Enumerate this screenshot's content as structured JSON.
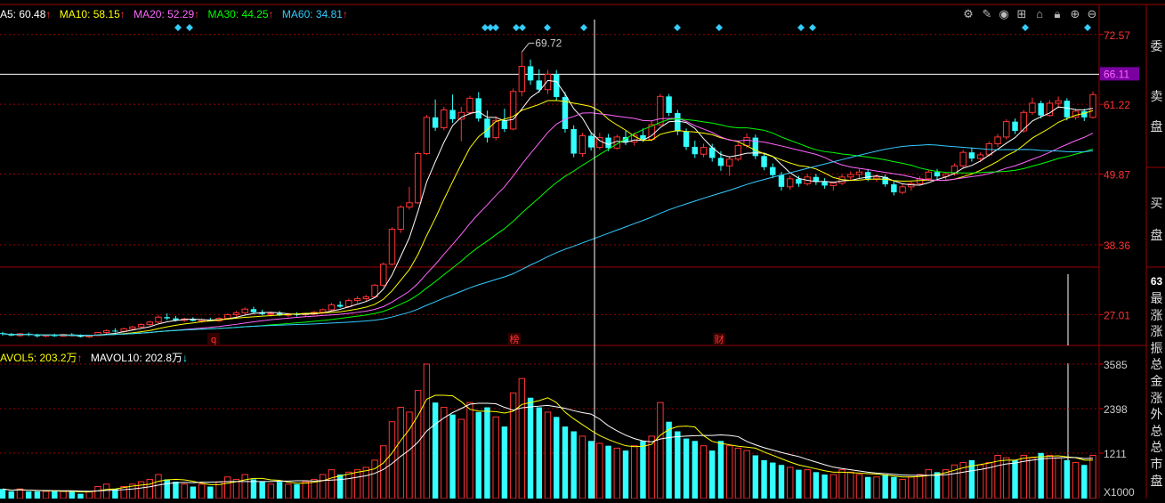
{
  "price_legend": [
    {
      "label": "A5: 60.48",
      "arrow": "↑",
      "color": "#ffffff"
    },
    {
      "label": "MA10: 58.15",
      "arrow": "↑",
      "color": "#ffff00"
    },
    {
      "label": "MA20: 52.29",
      "arrow": "↑",
      "color": "#ff66ff"
    },
    {
      "label": "MA30: 44.25",
      "arrow": "↑",
      "color": "#00ff00"
    },
    {
      "label": "MA60: 34.81",
      "arrow": "↑",
      "color": "#33ccff"
    }
  ],
  "volume_legend": [
    {
      "label": "AVOL5: 203.2万",
      "arrow": "↑",
      "color": "#ffff00"
    },
    {
      "label": "MAVOL10: 202.8万",
      "arrow": "↓",
      "color": "#ffffff"
    }
  ],
  "price_axis": [
    "72.57",
    "61.22",
    "49.87",
    "38.36",
    "27.01"
  ],
  "current_price": "66.11",
  "high_annotation": "69.72",
  "volume_axis": [
    "3585",
    "2398",
    "1211"
  ],
  "volume_unit": "X1000",
  "event_markers": [
    {
      "text": "q",
      "color": "#ff3333"
    },
    {
      "text": "榜",
      "color": "#ff3333"
    },
    {
      "text": "财",
      "color": "#ff3333"
    }
  ],
  "side_panel": {
    "top": "委",
    "sell": [
      "卖",
      "盘"
    ],
    "buy": [
      "买",
      "盘"
    ],
    "number": "63",
    "labels": [
      "最",
      "涨",
      "涨",
      "振",
      "总",
      "金",
      "涨",
      "外",
      "总",
      "总",
      "市",
      "盘"
    ]
  },
  "colors": {
    "up": "#ff3333",
    "down": "#33ffff",
    "grid": "#990000",
    "ma5": "#ffffff",
    "ma10": "#ffff00",
    "ma20": "#ff66ff",
    "ma30": "#00ff00",
    "ma60": "#33ccff"
  },
  "chart_data": {
    "type": "candlestick",
    "ylim": [
      22,
      75
    ],
    "yticks": [
      72.57,
      61.22,
      49.87,
      38.36,
      27.01
    ],
    "high": 69.72,
    "last": 66.11,
    "volume_ticks": [
      3585,
      2398,
      1211
    ],
    "candles": [
      [
        24,
        24.2,
        23.6,
        23.9
      ],
      [
        23.9,
        24,
        23.5,
        23.6
      ],
      [
        23.6,
        24,
        23.4,
        23.9
      ],
      [
        23.9,
        24.1,
        23.5,
        23.7
      ],
      [
        23.7,
        23.9,
        23.3,
        23.5
      ],
      [
        23.5,
        23.8,
        23.3,
        23.7
      ],
      [
        23.7,
        23.9,
        23.4,
        23.5
      ],
      [
        23.5,
        23.9,
        23.4,
        23.8
      ],
      [
        23.8,
        24,
        23.5,
        23.6
      ],
      [
        23.6,
        23.8,
        23.3,
        23.4
      ],
      [
        23.4,
        23.7,
        23.2,
        23.6
      ],
      [
        23.6,
        24.2,
        23.5,
        24.1
      ],
      [
        24.1,
        24.6,
        23.9,
        24.4
      ],
      [
        24.4,
        24.8,
        24.1,
        24.3
      ],
      [
        24.3,
        24.9,
        24.1,
        24.7
      ],
      [
        24.7,
        25.2,
        24.5,
        25
      ],
      [
        25,
        25.6,
        24.8,
        25.4
      ],
      [
        25.4,
        26,
        25.2,
        25.8
      ],
      [
        25.8,
        26.9,
        25.6,
        26.6
      ],
      [
        26.6,
        27.2,
        26.1,
        26.4
      ],
      [
        26.4,
        26.8,
        25.9,
        26.1
      ],
      [
        26.1,
        26.5,
        25.8,
        26.3
      ],
      [
        26.3,
        26.6,
        25.9,
        26
      ],
      [
        26,
        26.4,
        25.7,
        26.2
      ],
      [
        26.2,
        26.5,
        25.9,
        26
      ],
      [
        26,
        26.6,
        25.8,
        26.4
      ],
      [
        26.4,
        27.2,
        26.2,
        27
      ],
      [
        27,
        27.6,
        26.7,
        27.3
      ],
      [
        27.3,
        28.2,
        27,
        27.9
      ],
      [
        27.9,
        28.3,
        27.2,
        27.4
      ],
      [
        27.4,
        27.8,
        26.9,
        27.1
      ],
      [
        27.1,
        27.5,
        26.7,
        27.2
      ],
      [
        27.2,
        27.6,
        26.8,
        26.9
      ],
      [
        26.9,
        27.3,
        26.6,
        27.1
      ],
      [
        27.1,
        27.4,
        26.7,
        27
      ],
      [
        27,
        27.3,
        26.7,
        27.2
      ],
      [
        27.2,
        27.6,
        26.9,
        27.4
      ],
      [
        27.4,
        28,
        27.1,
        27.8
      ],
      [
        27.8,
        28.9,
        27.6,
        28.6
      ],
      [
        28.6,
        29.2,
        28.1,
        28.3
      ],
      [
        28.3,
        29.6,
        28.1,
        29.3
      ],
      [
        29.3,
        30,
        28.9,
        29.6
      ],
      [
        29.6,
        30.2,
        29.2,
        29.9
      ],
      [
        29.9,
        32,
        29.7,
        31.8
      ],
      [
        31.8,
        35.5,
        31.5,
        35.2
      ],
      [
        35.2,
        41.2,
        35,
        40.9
      ],
      [
        40.9,
        44.8,
        40.3,
        44.5
      ],
      [
        44.5,
        47.8,
        44.1,
        45.2
      ],
      [
        45.2,
        53.5,
        45,
        53.2
      ],
      [
        53.2,
        59.5,
        53,
        59.1
      ],
      [
        59.1,
        62,
        56.9,
        57.4
      ],
      [
        57.4,
        60.8,
        57,
        60.3
      ],
      [
        60.3,
        62.8,
        58.2,
        58.8
      ],
      [
        58.8,
        60.8,
        55.2,
        59.9
      ],
      [
        59.9,
        62.6,
        59.5,
        62.2
      ],
      [
        62.2,
        63.2,
        58.4,
        58.9
      ],
      [
        58.9,
        60.2,
        55,
        55.8
      ],
      [
        55.8,
        59.3,
        55.4,
        58.6
      ],
      [
        58.6,
        60.5,
        56.7,
        57.2
      ],
      [
        57.2,
        63.8,
        57,
        63.3
      ],
      [
        63.3,
        69.72,
        62.5,
        67.4
      ],
      [
        67.4,
        68.5,
        64.4,
        65.1
      ],
      [
        65.1,
        66.9,
        63.1,
        63.6
      ],
      [
        63.6,
        66.8,
        62.9,
        66.1
      ],
      [
        66.1,
        66.8,
        61.8,
        62.4
      ],
      [
        62.4,
        63.2,
        56.6,
        57.2
      ],
      [
        57.2,
        57.8,
        52.6,
        53.2
      ],
      [
        53.2,
        56.6,
        52.7,
        56.1
      ],
      [
        56.1,
        56.6,
        53.7,
        54.2
      ],
      [
        54.2,
        56.6,
        53.9,
        55.8
      ],
      [
        55.8,
        56.4,
        53.6,
        54.1
      ],
      [
        54.1,
        56.3,
        53.8,
        55.9
      ],
      [
        55.9,
        56.9,
        54.6,
        55.1
      ],
      [
        55.1,
        56.6,
        54.5,
        56.2
      ],
      [
        56.2,
        57.3,
        55.1,
        55.5
      ],
      [
        55.5,
        58.6,
        55.2,
        57.9
      ],
      [
        57.9,
        62.9,
        57.7,
        62.5
      ],
      [
        62.5,
        62.9,
        59.3,
        59.8
      ],
      [
        59.8,
        60.3,
        56.2,
        56.8
      ],
      [
        56.8,
        57.3,
        53.8,
        54.3
      ],
      [
        54.3,
        55.3,
        52.5,
        53.1
      ],
      [
        53.1,
        54.8,
        52.6,
        54.2
      ],
      [
        54.2,
        54.8,
        51.9,
        52.5
      ],
      [
        52.5,
        53.6,
        50.4,
        51.2
      ],
      [
        51.2,
        52.8,
        49.6,
        52.3
      ],
      [
        52.3,
        54.9,
        52,
        54.5
      ],
      [
        54.5,
        56.5,
        54.1,
        55.8
      ],
      [
        55.8,
        56.3,
        52.3,
        52.8
      ],
      [
        52.8,
        53.3,
        50.5,
        51
      ],
      [
        51,
        51.6,
        49.2,
        49.7
      ],
      [
        49.7,
        50.2,
        47.2,
        47.8
      ],
      [
        47.8,
        49.6,
        47.3,
        49.1
      ],
      [
        49.1,
        49.6,
        47.8,
        48.3
      ],
      [
        48.3,
        49.9,
        48,
        49.4
      ],
      [
        49.4,
        49.9,
        48.1,
        48.6
      ],
      [
        48.6,
        49.2,
        47.5,
        48
      ],
      [
        48,
        48.6,
        47.2,
        48.4
      ],
      [
        48.4,
        49.8,
        48.1,
        49.4
      ],
      [
        49.4,
        50.3,
        48.9,
        49.8
      ],
      [
        49.8,
        50.7,
        49.2,
        50.2
      ],
      [
        50.2,
        50.7,
        48.7,
        49.1
      ],
      [
        49.1,
        49.8,
        48.6,
        49.4
      ],
      [
        49.4,
        49.8,
        47.8,
        48.2
      ],
      [
        48.2,
        48.7,
        46.4,
        46.9
      ],
      [
        46.9,
        48.2,
        46.6,
        47.8
      ],
      [
        47.8,
        48.7,
        47.2,
        48.3
      ],
      [
        48.3,
        49.5,
        48,
        49.1
      ],
      [
        49.1,
        50.5,
        48.8,
        50.2
      ],
      [
        50.2,
        50.7,
        49,
        49.5
      ],
      [
        49.5,
        50.2,
        48.8,
        49.9
      ],
      [
        49.9,
        51.6,
        49.6,
        51.2
      ],
      [
        51.2,
        53.8,
        50.8,
        53.4
      ],
      [
        53.4,
        54.2,
        51.9,
        52.4
      ],
      [
        52.4,
        53.4,
        51.8,
        53
      ],
      [
        53,
        55.2,
        52.7,
        54.8
      ],
      [
        54.8,
        56.4,
        54.3,
        55.9
      ],
      [
        55.9,
        58.8,
        55.5,
        58.4
      ],
      [
        58.4,
        58.9,
        56.4,
        56.9
      ],
      [
        56.9,
        60.3,
        56.6,
        59.9
      ],
      [
        59.9,
        62.3,
        59.5,
        61.4
      ],
      [
        61.4,
        61.8,
        58.9,
        59.4
      ],
      [
        59.4,
        61.9,
        59.2,
        61.4
      ],
      [
        61.4,
        62.5,
        60.6,
        61.8
      ],
      [
        61.8,
        62.2,
        58.6,
        59.1
      ],
      [
        59.1,
        60.5,
        58.7,
        60.1
      ],
      [
        60.1,
        60.5,
        58.5,
        59.1
      ],
      [
        59.1,
        63.3,
        58.9,
        62.8
      ]
    ],
    "volumes": [
      4,
      3,
      4,
      3,
      3,
      3,
      3,
      3,
      3,
      2,
      3,
      5,
      6,
      4,
      5,
      6,
      7,
      8,
      10,
      8,
      7,
      6,
      5,
      6,
      5,
      7,
      9,
      8,
      10,
      8,
      7,
      6,
      7,
      6,
      6,
      7,
      8,
      10,
      12,
      10,
      11,
      12,
      13,
      16,
      22,
      32,
      38,
      36,
      45,
      56,
      40,
      38,
      35,
      33,
      40,
      36,
      38,
      34,
      30,
      44,
      50,
      42,
      38,
      36,
      34,
      30,
      28,
      26,
      24,
      23,
      22,
      21,
      20,
      22,
      24,
      26,
      40,
      32,
      28,
      25,
      24,
      22,
      20,
      24,
      22,
      21,
      20,
      18,
      16,
      15,
      14,
      13,
      12,
      12,
      11,
      10,
      10,
      12,
      11,
      10,
      9,
      9,
      10,
      9,
      8,
      9,
      10,
      12,
      11,
      12,
      14,
      15,
      16,
      14,
      15,
      18,
      17,
      16,
      18,
      17,
      19,
      18,
      17,
      16,
      15,
      14,
      18
    ]
  }
}
